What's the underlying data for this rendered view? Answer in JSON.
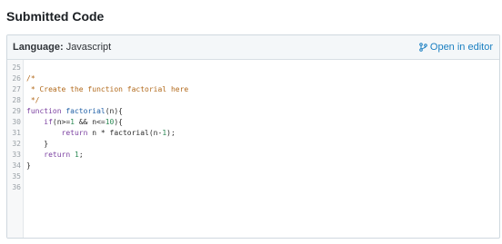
{
  "page": {
    "title": "Submitted Code"
  },
  "panel": {
    "language_label": "Language:",
    "language_value": "Javascript",
    "open_editor_label": "Open in editor",
    "icon": "branch-icon"
  },
  "colors": {
    "link": "#1a7fc1",
    "comment": "#b26a1c",
    "keyword": "#7a3fa0",
    "function": "#1f5fa6",
    "number": "#2e8b57",
    "header_bg": "#f4f7f9"
  },
  "code": {
    "line_numbers": [
      "25",
      "26",
      "27",
      "28",
      "29",
      "30",
      "31",
      "32",
      "33",
      "34",
      "35",
      "36"
    ],
    "lines": [
      [],
      [
        {
          "t": "c",
          "v": "/*"
        }
      ],
      [
        {
          "t": "c",
          "v": " * Create the function factorial here"
        }
      ],
      [
        {
          "t": "c",
          "v": " */"
        }
      ],
      [
        {
          "t": "k",
          "v": "function"
        },
        {
          "t": "p",
          "v": " "
        },
        {
          "t": "f",
          "v": "factorial"
        },
        {
          "t": "p",
          "v": "(n){"
        }
      ],
      [
        {
          "t": "p",
          "v": "    "
        },
        {
          "t": "k",
          "v": "if"
        },
        {
          "t": "p",
          "v": "(n>="
        },
        {
          "t": "n",
          "v": "1"
        },
        {
          "t": "p",
          "v": " && n<="
        },
        {
          "t": "n",
          "v": "10"
        },
        {
          "t": "p",
          "v": "){"
        }
      ],
      [
        {
          "t": "p",
          "v": "        "
        },
        {
          "t": "k",
          "v": "return"
        },
        {
          "t": "p",
          "v": " n * factorial(n-"
        },
        {
          "t": "n",
          "v": "1"
        },
        {
          "t": "p",
          "v": ");"
        }
      ],
      [
        {
          "t": "p",
          "v": "    }"
        }
      ],
      [
        {
          "t": "p",
          "v": "    "
        },
        {
          "t": "k",
          "v": "return"
        },
        {
          "t": "p",
          "v": " "
        },
        {
          "t": "n",
          "v": "1"
        },
        {
          "t": "p",
          "v": ";"
        }
      ],
      [
        {
          "t": "p",
          "v": "}"
        }
      ],
      [],
      []
    ]
  }
}
